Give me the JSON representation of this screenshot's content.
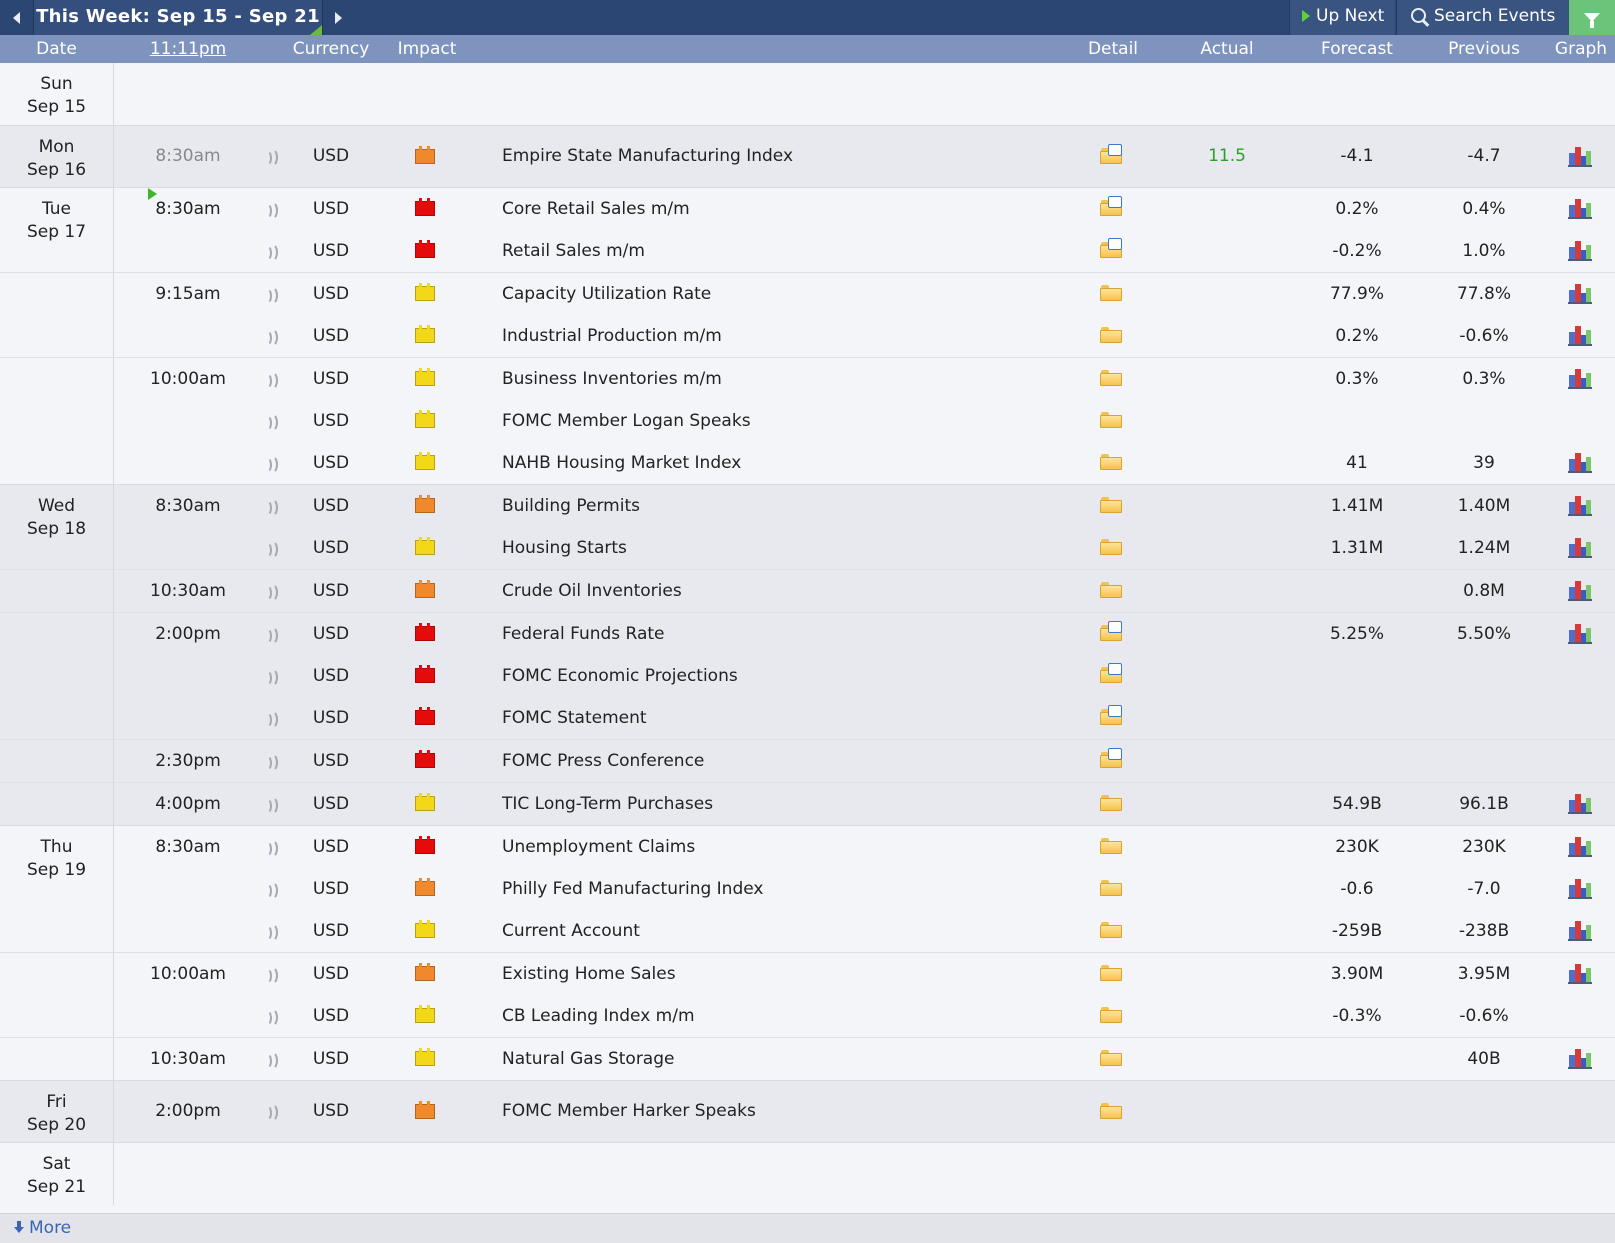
{
  "toolbar": {
    "week_title": "This Week: Sep 15 - Sep 21",
    "up_next": "Up Next",
    "search_events": "Search Events"
  },
  "header": {
    "date": "Date",
    "time": "11:11pm",
    "currency": "Currency",
    "impact": "Impact",
    "detail": "Detail",
    "actual": "Actual",
    "forecast": "Forecast",
    "previous": "Previous",
    "graph": "Graph"
  },
  "impact_colors": {
    "high": "#e60b0b",
    "medium": "#f0892b",
    "low": "#f3d81a"
  },
  "actual_color_good": "#2aa02a",
  "days": [
    {
      "dow": "Sun",
      "date": "Sep 15",
      "shade": "plain",
      "height": 62,
      "events": []
    },
    {
      "dow": "Mon",
      "date": "Sep 16",
      "shade": "alt",
      "events": [
        {
          "time": "8:30am",
          "past": true,
          "currency": "USD",
          "impact": "medium",
          "event": "Empire State Manufacturing Index",
          "detail": "doc",
          "actual": "11.5",
          "forecast": "-4.1",
          "previous": "-4.7",
          "graph": true,
          "tall": true
        }
      ]
    },
    {
      "dow": "Tue",
      "date": "Sep 17",
      "shade": "plain",
      "events": [
        {
          "time": "8:30am",
          "next": true,
          "currency": "USD",
          "impact": "high",
          "event": "Core Retail Sales m/m",
          "detail": "doc",
          "actual": "",
          "forecast": "0.2%",
          "previous": "0.4%",
          "graph": true
        },
        {
          "time": "",
          "currency": "USD",
          "impact": "high",
          "event": "Retail Sales m/m",
          "detail": "doc",
          "actual": "",
          "forecast": "-0.2%",
          "previous": "1.0%",
          "graph": true
        },
        {
          "time": "9:15am",
          "currency": "USD",
          "impact": "low",
          "event": "Capacity Utilization Rate",
          "detail": "plain",
          "actual": "",
          "forecast": "77.9%",
          "previous": "77.8%",
          "graph": true
        },
        {
          "time": "",
          "currency": "USD",
          "impact": "low",
          "event": "Industrial Production m/m",
          "detail": "plain",
          "actual": "",
          "forecast": "0.2%",
          "previous": "-0.6%",
          "graph": true
        },
        {
          "time": "10:00am",
          "currency": "USD",
          "impact": "low",
          "event": "Business Inventories m/m",
          "detail": "plain",
          "actual": "",
          "forecast": "0.3%",
          "previous": "0.3%",
          "graph": true
        },
        {
          "time": "",
          "currency": "USD",
          "impact": "low",
          "event": "FOMC Member Logan Speaks",
          "detail": "plain",
          "actual": "",
          "forecast": "",
          "previous": "",
          "graph": false
        },
        {
          "time": "",
          "currency": "USD",
          "impact": "low",
          "event": "NAHB Housing Market Index",
          "detail": "plain",
          "actual": "",
          "forecast": "41",
          "previous": "39",
          "graph": true
        }
      ]
    },
    {
      "dow": "Wed",
      "date": "Sep 18",
      "shade": "alt",
      "events": [
        {
          "time": "8:30am",
          "currency": "USD",
          "impact": "medium",
          "event": "Building Permits",
          "detail": "plain",
          "actual": "",
          "forecast": "1.41M",
          "previous": "1.40M",
          "graph": true
        },
        {
          "time": "",
          "currency": "USD",
          "impact": "low",
          "event": "Housing Starts",
          "detail": "plain",
          "actual": "",
          "forecast": "1.31M",
          "previous": "1.24M",
          "graph": true
        },
        {
          "time": "10:30am",
          "currency": "USD",
          "impact": "medium",
          "event": "Crude Oil Inventories",
          "detail": "plain",
          "actual": "",
          "forecast": "",
          "previous": "0.8M",
          "graph": true
        },
        {
          "time": "2:00pm",
          "currency": "USD",
          "impact": "high",
          "event": "Federal Funds Rate",
          "detail": "doc",
          "actual": "",
          "forecast": "5.25%",
          "previous": "5.50%",
          "graph": true
        },
        {
          "time": "",
          "currency": "USD",
          "impact": "high",
          "event": "FOMC Economic Projections",
          "detail": "doc",
          "actual": "",
          "forecast": "",
          "previous": "",
          "graph": false
        },
        {
          "time": "",
          "currency": "USD",
          "impact": "high",
          "event": "FOMC Statement",
          "detail": "doc",
          "actual": "",
          "forecast": "",
          "previous": "",
          "graph": false
        },
        {
          "time": "2:30pm",
          "currency": "USD",
          "impact": "high",
          "event": "FOMC Press Conference",
          "detail": "doc",
          "actual": "",
          "forecast": "",
          "previous": "",
          "graph": false
        },
        {
          "time": "4:00pm",
          "currency": "USD",
          "impact": "low",
          "event": "TIC Long-Term Purchases",
          "detail": "plain",
          "actual": "",
          "forecast": "54.9B",
          "previous": "96.1B",
          "graph": true
        }
      ]
    },
    {
      "dow": "Thu",
      "date": "Sep 19",
      "shade": "plain",
      "events": [
        {
          "time": "8:30am",
          "currency": "USD",
          "impact": "high",
          "event": "Unemployment Claims",
          "detail": "plain",
          "actual": "",
          "forecast": "230K",
          "previous": "230K",
          "graph": true
        },
        {
          "time": "",
          "currency": "USD",
          "impact": "medium",
          "event": "Philly Fed Manufacturing Index",
          "detail": "plain",
          "actual": "",
          "forecast": "-0.6",
          "previous": "-7.0",
          "graph": true
        },
        {
          "time": "",
          "currency": "USD",
          "impact": "low",
          "event": "Current Account",
          "detail": "plain",
          "actual": "",
          "forecast": "-259B",
          "previous": "-238B",
          "graph": true
        },
        {
          "time": "10:00am",
          "currency": "USD",
          "impact": "medium",
          "event": "Existing Home Sales",
          "detail": "plain",
          "actual": "",
          "forecast": "3.90M",
          "previous": "3.95M",
          "graph": true
        },
        {
          "time": "",
          "currency": "USD",
          "impact": "low",
          "event": "CB Leading Index m/m",
          "detail": "plain",
          "actual": "",
          "forecast": "-0.3%",
          "previous": "-0.6%",
          "graph": false
        },
        {
          "time": "10:30am",
          "currency": "USD",
          "impact": "low",
          "event": "Natural Gas Storage",
          "detail": "plain",
          "actual": "",
          "forecast": "",
          "previous": "40B",
          "graph": true
        }
      ]
    },
    {
      "dow": "Fri",
      "date": "Sep 20",
      "shade": "alt",
      "events": [
        {
          "time": "2:00pm",
          "currency": "USD",
          "impact": "medium",
          "event": "FOMC Member Harker Speaks",
          "detail": "plain",
          "actual": "",
          "forecast": "",
          "previous": "",
          "graph": false,
          "tall": true
        }
      ]
    },
    {
      "dow": "Sat",
      "date": "Sep 21",
      "shade": "plain",
      "events": []
    }
  ],
  "footer": {
    "more": "More"
  }
}
